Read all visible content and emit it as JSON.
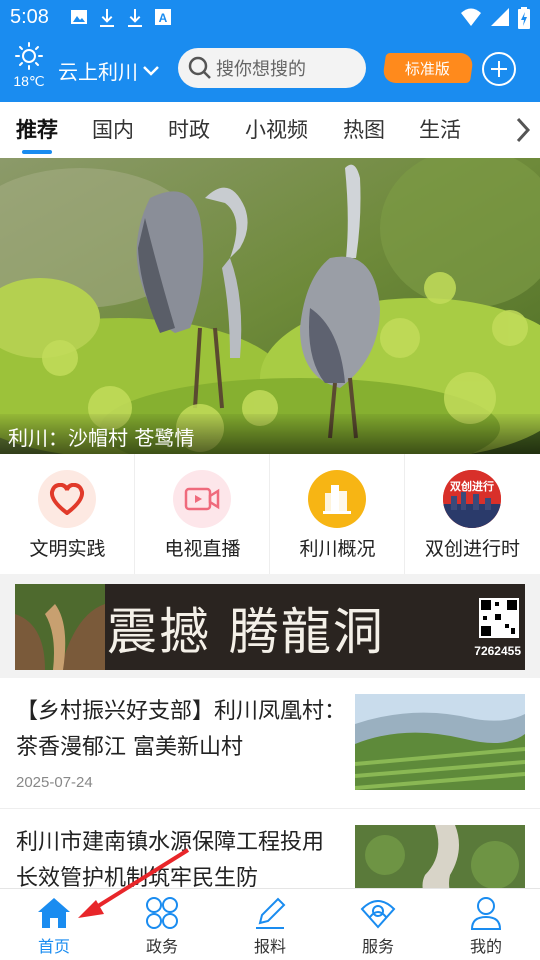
{
  "status_bar": {
    "time": "5:08"
  },
  "header": {
    "temperature": "18℃",
    "location": "云上利川",
    "search_placeholder": "搜你想搜的",
    "mode_badge": "标准版",
    "accent_color": "#1a8cf0"
  },
  "tabs": [
    {
      "label": "推荐",
      "active": true
    },
    {
      "label": "国内"
    },
    {
      "label": "时政"
    },
    {
      "label": "小视频"
    },
    {
      "label": "热图"
    },
    {
      "label": "生活"
    }
  ],
  "hero": {
    "caption": "利川：沙帽村 苍鹭情"
  },
  "shortcuts": [
    {
      "label": "文明实践",
      "icon": "heart-icon"
    },
    {
      "label": "电视直播",
      "icon": "video-camera-icon"
    },
    {
      "label": "利川概况",
      "icon": "building-icon"
    },
    {
      "label": "双创进行时",
      "icon": "city-skyline-icon",
      "icon_text": "双创进行"
    }
  ],
  "banner": {
    "title": "震撼 腾龍洞",
    "phone": "7262455"
  },
  "news": [
    {
      "title": "【乡村振兴好支部】利川凤凰村：茶香漫郁江 富美新山村",
      "date": "2025-07-24"
    },
    {
      "title": "利川市建南镇水源保障工程投用 长效管护机制筑牢民生防"
    }
  ],
  "bottom_nav": [
    {
      "label": "首页",
      "icon": "home-icon",
      "active": true
    },
    {
      "label": "政务",
      "icon": "grid-icon"
    },
    {
      "label": "报料",
      "icon": "pen-icon"
    },
    {
      "label": "服务",
      "icon": "service-icon"
    },
    {
      "label": "我的",
      "icon": "user-icon"
    }
  ]
}
